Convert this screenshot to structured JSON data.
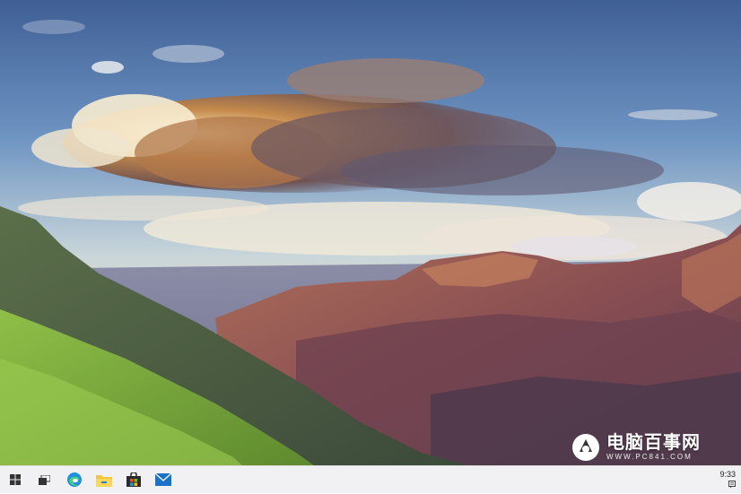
{
  "wallpaper": {
    "description_icon": "mountain-landscape-wallpaper"
  },
  "watermark": {
    "title": "电脑百事网",
    "subtitle": "WWW.PC841.COM"
  },
  "taskbar": {
    "icons": [
      "windows-start-icon",
      "task-view-icon",
      "edge-browser-icon",
      "file-explorer-icon",
      "microsoft-store-icon",
      "mail-icon"
    ],
    "clock": "9:33"
  },
  "colors": {
    "taskbar_bg": "#f1f1f3",
    "edge_blue": "#1e90e0",
    "explorer_yellow": "#f4c542",
    "store_dark": "#2b2b2b",
    "mail_blue": "#1a73c8"
  }
}
